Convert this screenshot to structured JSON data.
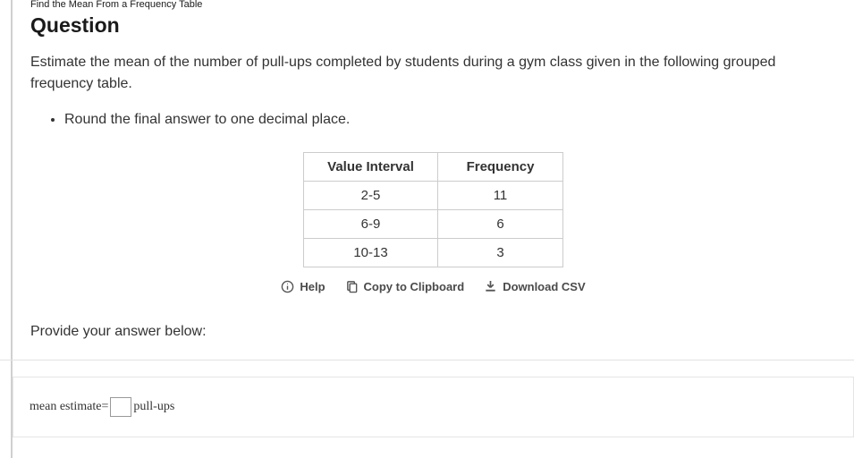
{
  "pretitle": "Find the Mean From a Frequency Table",
  "heading": "Question",
  "prompt": "Estimate the mean of the number of pull-ups completed by students during a gym class given in the following grouped frequency table.",
  "instructions": [
    "Round the final answer to one decimal place."
  ],
  "table": {
    "headers": [
      "Value Interval",
      "Frequency"
    ],
    "rows": [
      [
        "2-5",
        "11"
      ],
      [
        "6-9",
        "6"
      ],
      [
        "10-13",
        "3"
      ]
    ]
  },
  "actions": {
    "help": "Help",
    "copy": "Copy to Clipboard",
    "download": "Download CSV"
  },
  "provide_label": "Provide your answer below:",
  "answer": {
    "label_before": "mean estimate=",
    "value": "",
    "unit": "pull-ups"
  },
  "chart_data": {
    "type": "table",
    "columns": [
      "Value Interval",
      "Frequency"
    ],
    "rows": [
      {
        "interval": "2-5",
        "frequency": 11
      },
      {
        "interval": "6-9",
        "frequency": 6
      },
      {
        "interval": "10-13",
        "frequency": 3
      }
    ]
  }
}
